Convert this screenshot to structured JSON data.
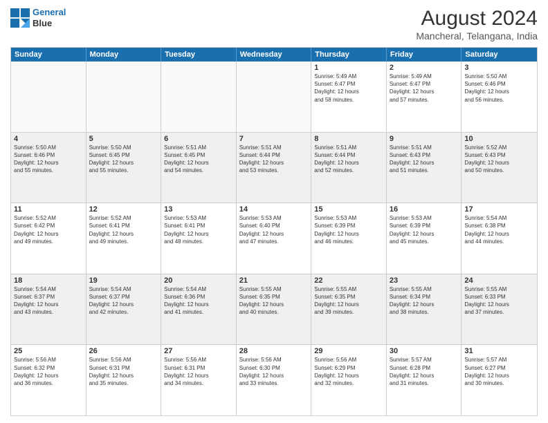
{
  "header": {
    "logo_line1": "General",
    "logo_line2": "Blue",
    "month_year": "August 2024",
    "location": "Mancheral, Telangana, India"
  },
  "weekdays": [
    "Sunday",
    "Monday",
    "Tuesday",
    "Wednesday",
    "Thursday",
    "Friday",
    "Saturday"
  ],
  "weeks": [
    [
      {
        "day": "",
        "info": ""
      },
      {
        "day": "",
        "info": ""
      },
      {
        "day": "",
        "info": ""
      },
      {
        "day": "",
        "info": ""
      },
      {
        "day": "1",
        "info": "Sunrise: 5:49 AM\nSunset: 6:47 PM\nDaylight: 12 hours\nand 58 minutes."
      },
      {
        "day": "2",
        "info": "Sunrise: 5:49 AM\nSunset: 6:47 PM\nDaylight: 12 hours\nand 57 minutes."
      },
      {
        "day": "3",
        "info": "Sunrise: 5:50 AM\nSunset: 6:46 PM\nDaylight: 12 hours\nand 56 minutes."
      }
    ],
    [
      {
        "day": "4",
        "info": "Sunrise: 5:50 AM\nSunset: 6:46 PM\nDaylight: 12 hours\nand 55 minutes."
      },
      {
        "day": "5",
        "info": "Sunrise: 5:50 AM\nSunset: 6:45 PM\nDaylight: 12 hours\nand 55 minutes."
      },
      {
        "day": "6",
        "info": "Sunrise: 5:51 AM\nSunset: 6:45 PM\nDaylight: 12 hours\nand 54 minutes."
      },
      {
        "day": "7",
        "info": "Sunrise: 5:51 AM\nSunset: 6:44 PM\nDaylight: 12 hours\nand 53 minutes."
      },
      {
        "day": "8",
        "info": "Sunrise: 5:51 AM\nSunset: 6:44 PM\nDaylight: 12 hours\nand 52 minutes."
      },
      {
        "day": "9",
        "info": "Sunrise: 5:51 AM\nSunset: 6:43 PM\nDaylight: 12 hours\nand 51 minutes."
      },
      {
        "day": "10",
        "info": "Sunrise: 5:52 AM\nSunset: 6:43 PM\nDaylight: 12 hours\nand 50 minutes."
      }
    ],
    [
      {
        "day": "11",
        "info": "Sunrise: 5:52 AM\nSunset: 6:42 PM\nDaylight: 12 hours\nand 49 minutes."
      },
      {
        "day": "12",
        "info": "Sunrise: 5:52 AM\nSunset: 6:41 PM\nDaylight: 12 hours\nand 49 minutes."
      },
      {
        "day": "13",
        "info": "Sunrise: 5:53 AM\nSunset: 6:41 PM\nDaylight: 12 hours\nand 48 minutes."
      },
      {
        "day": "14",
        "info": "Sunrise: 5:53 AM\nSunset: 6:40 PM\nDaylight: 12 hours\nand 47 minutes."
      },
      {
        "day": "15",
        "info": "Sunrise: 5:53 AM\nSunset: 6:39 PM\nDaylight: 12 hours\nand 46 minutes."
      },
      {
        "day": "16",
        "info": "Sunrise: 5:53 AM\nSunset: 6:39 PM\nDaylight: 12 hours\nand 45 minutes."
      },
      {
        "day": "17",
        "info": "Sunrise: 5:54 AM\nSunset: 6:38 PM\nDaylight: 12 hours\nand 44 minutes."
      }
    ],
    [
      {
        "day": "18",
        "info": "Sunrise: 5:54 AM\nSunset: 6:37 PM\nDaylight: 12 hours\nand 43 minutes."
      },
      {
        "day": "19",
        "info": "Sunrise: 5:54 AM\nSunset: 6:37 PM\nDaylight: 12 hours\nand 42 minutes."
      },
      {
        "day": "20",
        "info": "Sunrise: 5:54 AM\nSunset: 6:36 PM\nDaylight: 12 hours\nand 41 minutes."
      },
      {
        "day": "21",
        "info": "Sunrise: 5:55 AM\nSunset: 6:35 PM\nDaylight: 12 hours\nand 40 minutes."
      },
      {
        "day": "22",
        "info": "Sunrise: 5:55 AM\nSunset: 6:35 PM\nDaylight: 12 hours\nand 39 minutes."
      },
      {
        "day": "23",
        "info": "Sunrise: 5:55 AM\nSunset: 6:34 PM\nDaylight: 12 hours\nand 38 minutes."
      },
      {
        "day": "24",
        "info": "Sunrise: 5:55 AM\nSunset: 6:33 PM\nDaylight: 12 hours\nand 37 minutes."
      }
    ],
    [
      {
        "day": "25",
        "info": "Sunrise: 5:56 AM\nSunset: 6:32 PM\nDaylight: 12 hours\nand 36 minutes."
      },
      {
        "day": "26",
        "info": "Sunrise: 5:56 AM\nSunset: 6:31 PM\nDaylight: 12 hours\nand 35 minutes."
      },
      {
        "day": "27",
        "info": "Sunrise: 5:56 AM\nSunset: 6:31 PM\nDaylight: 12 hours\nand 34 minutes."
      },
      {
        "day": "28",
        "info": "Sunrise: 5:56 AM\nSunset: 6:30 PM\nDaylight: 12 hours\nand 33 minutes."
      },
      {
        "day": "29",
        "info": "Sunrise: 5:56 AM\nSunset: 6:29 PM\nDaylight: 12 hours\nand 32 minutes."
      },
      {
        "day": "30",
        "info": "Sunrise: 5:57 AM\nSunset: 6:28 PM\nDaylight: 12 hours\nand 31 minutes."
      },
      {
        "day": "31",
        "info": "Sunrise: 5:57 AM\nSunset: 6:27 PM\nDaylight: 12 hours\nand 30 minutes."
      }
    ]
  ]
}
